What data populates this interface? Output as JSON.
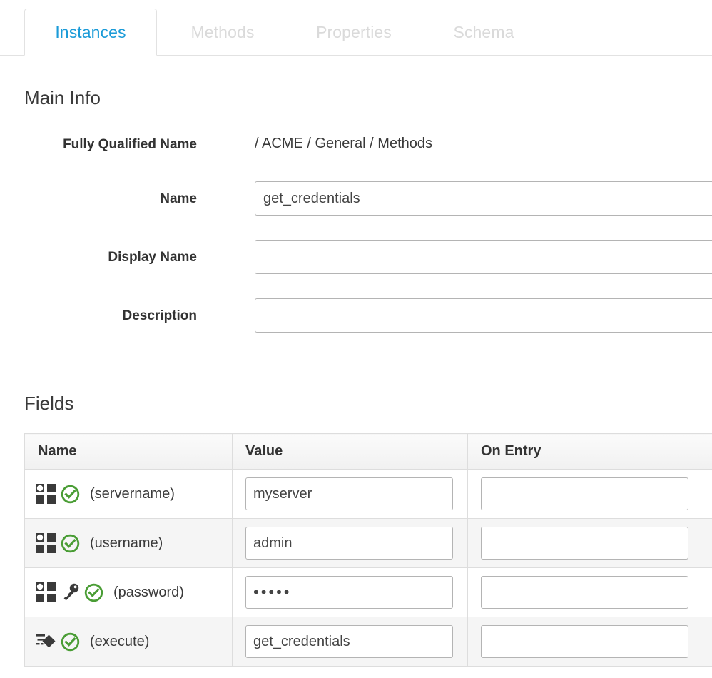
{
  "tabs": [
    {
      "label": "Instances",
      "active": true
    },
    {
      "label": "Methods",
      "active": false
    },
    {
      "label": "Properties",
      "active": false
    },
    {
      "label": "Schema",
      "active": false
    }
  ],
  "main_info": {
    "heading": "Main Info",
    "fqn_label": "Fully Qualified Name",
    "fqn_value": "/ ACME / General / Methods",
    "name_label": "Name",
    "name_value": "get_credentials",
    "display_name_label": "Display Name",
    "display_name_value": "",
    "description_label": "Description",
    "description_value": ""
  },
  "fields": {
    "heading": "Fields",
    "columns": [
      "Name",
      "Value",
      "On Entry",
      ""
    ],
    "rows": [
      {
        "name": "(servername)",
        "value": "myserver",
        "on_entry": "",
        "icons": [
          "grid-icon",
          "check-circle-icon"
        ],
        "password": false
      },
      {
        "name": "(username)",
        "value": "admin",
        "on_entry": "",
        "icons": [
          "grid-icon",
          "check-circle-icon"
        ],
        "password": false
      },
      {
        "name": "(password)",
        "value": "•••••",
        "on_entry": "",
        "icons": [
          "grid-icon",
          "key-icon",
          "check-circle-icon"
        ],
        "password": true
      },
      {
        "name": "(execute)",
        "value": "get_credentials",
        "on_entry": "",
        "icons": [
          "execute-icon",
          "check-circle-icon"
        ],
        "password": false
      }
    ]
  },
  "colors": {
    "active_tab_text": "#1b9bd8",
    "inactive_tab_text": "#dadada",
    "check_green": "#4a9d35",
    "icon_dark": "#3a3a3a",
    "border": "#dddddd",
    "row_stripe": "#f5f5f5"
  }
}
